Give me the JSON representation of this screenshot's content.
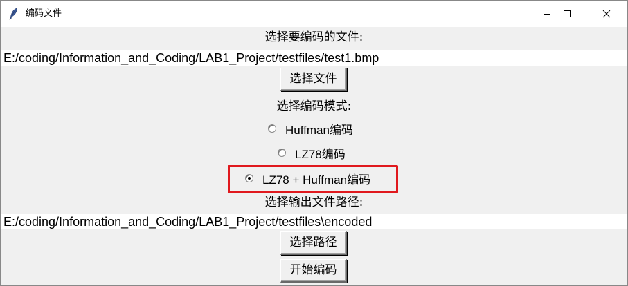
{
  "window": {
    "title": "编码文件",
    "controls": {
      "minimize": "–",
      "maximize": "☐",
      "close": "✕"
    }
  },
  "input_section": {
    "label": "选择要编码的文件:",
    "path": "E:/coding/Information_and_Coding/LAB1_Project/testfiles/test1.bmp",
    "button": "选择文件"
  },
  "mode_section": {
    "label": "选择编码模式:",
    "options": [
      {
        "label": "Huffman编码",
        "selected": false
      },
      {
        "label": "LZ78编码",
        "selected": false
      },
      {
        "label": "LZ78 + Huffman编码",
        "selected": true
      }
    ],
    "highlight_color": "#e0191e"
  },
  "output_section": {
    "label": "选择输出文件路径:",
    "path": "E:/coding/Information_and_Coding/LAB1_Project/testfiles\\encoded",
    "button": "选择路径"
  },
  "actions": {
    "start_button": "开始编码"
  }
}
